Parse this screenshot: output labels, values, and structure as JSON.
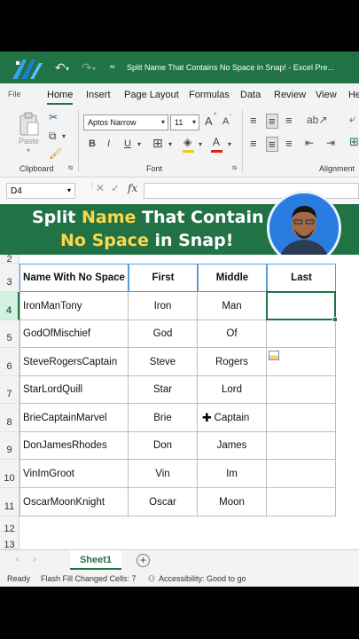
{
  "window": {
    "title": "Split Name That Contains No Space in Snap! - Excel Pre...",
    "file_label": "File"
  },
  "menu_tabs": [
    "Home",
    "Insert",
    "Page Layout",
    "Formulas",
    "Data",
    "Review",
    "View",
    "He"
  ],
  "active_tab": "Home",
  "ribbon": {
    "clipboard_label": "Clipboard",
    "paste_label": "Paste",
    "font_label": "Font",
    "alignment_label": "Alignment",
    "font_name": "Aptos Narrow",
    "font_size": "11",
    "bold": "B",
    "italic": "I",
    "underline": "U",
    "grow": "A",
    "shrink": "A"
  },
  "formula_bar": {
    "name_box": "D4",
    "fx": "fx",
    "value": ""
  },
  "banner": {
    "line1_a": "Split ",
    "line1_highlight": "Name",
    "line1_b": " That Contain",
    "line2_highlight": "No Space",
    "line2_b": " in Snap!"
  },
  "sheet": {
    "row_numbers": [
      "2",
      "3",
      "4",
      "5",
      "6",
      "7",
      "8",
      "9",
      "10",
      "11",
      "12",
      "13"
    ],
    "headers": [
      "Name With No Space",
      "First",
      "Middle",
      "Last"
    ],
    "rows": [
      {
        "name": "IronManTony",
        "first": "Iron",
        "middle": "Man",
        "last": ""
      },
      {
        "name": "GodOfMischief",
        "first": "God",
        "middle": "Of",
        "last": ""
      },
      {
        "name": "SteveRogersCaptain",
        "first": "Steve",
        "middle": "Rogers",
        "last": ""
      },
      {
        "name": "StarLordQuill",
        "first": "Star",
        "middle": "Lord",
        "last": ""
      },
      {
        "name": "BrieCaptainMarvel",
        "first": "Brie",
        "middle": "Captain",
        "last": ""
      },
      {
        "name": "DonJamesRhodes",
        "first": "Don",
        "middle": "James",
        "last": ""
      },
      {
        "name": "VinImGroot",
        "first": "Vin",
        "middle": "Im",
        "last": ""
      },
      {
        "name": "OscarMoonKnight",
        "first": "Oscar",
        "middle": "Moon",
        "last": ""
      }
    ],
    "selected_cell": "D4"
  },
  "sheet_tabs": {
    "active": "Sheet1",
    "add": "+"
  },
  "status": {
    "ready": "Ready",
    "flash_fill": "Flash Fill Changed Cells: 7",
    "accessibility": "Accessibility: Good to go"
  },
  "colors": {
    "excel_green": "#217346",
    "highlight_yellow": "#ffd84a",
    "header_border_blue": "#5b9bd5"
  }
}
